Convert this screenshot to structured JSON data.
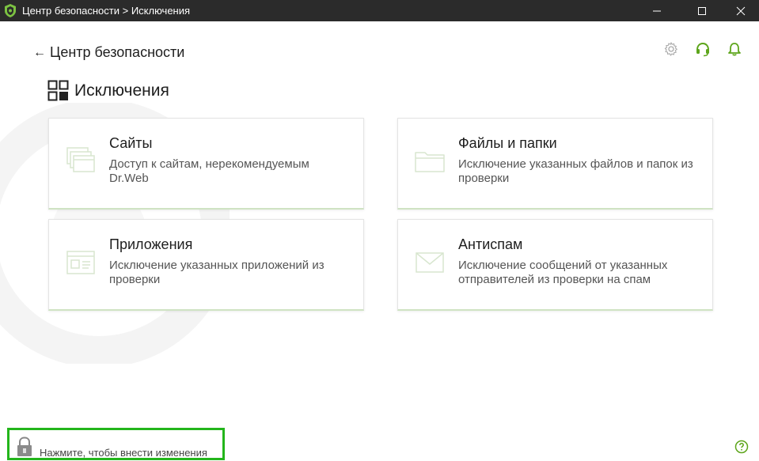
{
  "window": {
    "title": "Центр безопасности > Исключения",
    "accent": "#5da51b"
  },
  "header": {
    "back_label": "Центр безопасности",
    "icons": [
      "gear-icon",
      "headset-icon",
      "bell-icon"
    ]
  },
  "section": {
    "title": "Исключения"
  },
  "cards": [
    {
      "title": "Сайты",
      "description": "Доступ к сайтам, нерекомендуемым Dr.Web",
      "icon": "browser-windows-icon"
    },
    {
      "title": "Файлы и папки",
      "description": "Исключение указанных файлов и папок из проверки",
      "icon": "folder-icon"
    },
    {
      "title": "Приложения",
      "description": "Исключение указанных приложений из проверки",
      "icon": "app-window-icon"
    },
    {
      "title": "Антиспам",
      "description": "Исключение сообщений от указанных отправителей из проверки на спам",
      "icon": "envelope-icon"
    }
  ],
  "footer": {
    "lock_text": "Нажмите, чтобы внести изменения",
    "lock_highlight_color": "#23b51b",
    "help_icon": "help-icon"
  }
}
